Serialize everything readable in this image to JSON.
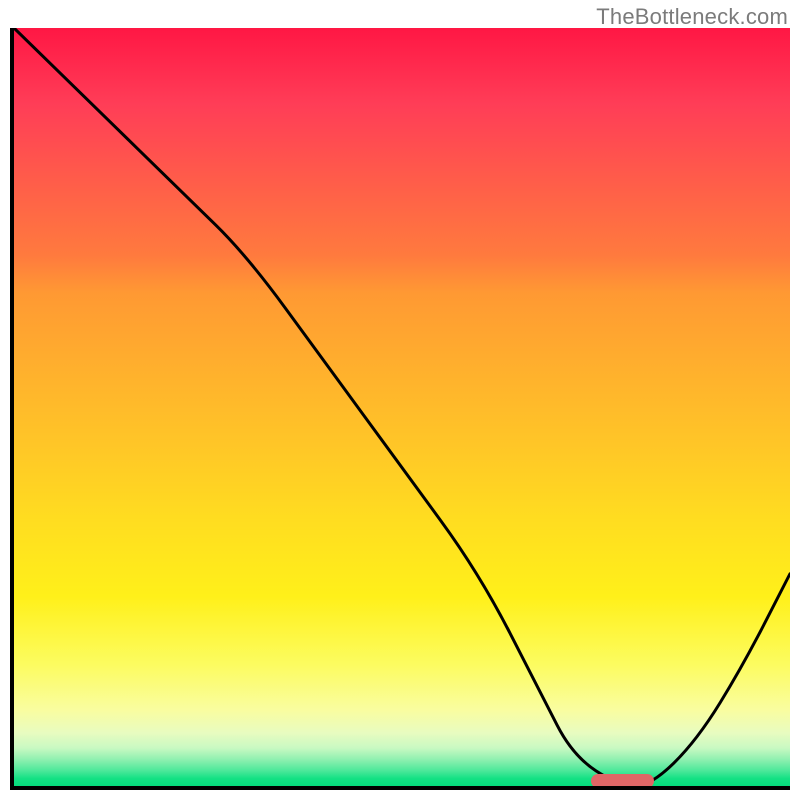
{
  "watermark": "TheBottleneck.com",
  "chart_data": {
    "type": "line",
    "title": "",
    "xlabel": "",
    "ylabel": "",
    "xlim": [
      0,
      100
    ],
    "ylim": [
      0,
      100
    ],
    "grid": false,
    "legend": false,
    "background_gradient": {
      "direction": "vertical",
      "stops": [
        {
          "pos": 0,
          "color": "#ff1744"
        },
        {
          "pos": 35,
          "color": "#ff9933"
        },
        {
          "pos": 65,
          "color": "#ffdd20"
        },
        {
          "pos": 90,
          "color": "#f9fda0"
        },
        {
          "pos": 100,
          "color": "#05dc7d"
        }
      ]
    },
    "series": [
      {
        "name": "bottleneck-curve",
        "color": "#000000",
        "x": [
          0,
          10,
          22,
          30,
          40,
          50,
          60,
          68,
          72,
          78,
          82,
          88,
          94,
          100
        ],
        "y": [
          100,
          90,
          78,
          70,
          56,
          42,
          28,
          12,
          4,
          0,
          0,
          6,
          16,
          28
        ]
      }
    ],
    "marker": {
      "name": "optimal-range",
      "x_start": 74,
      "x_end": 82,
      "y": 0.5,
      "color": "#e06666"
    }
  }
}
